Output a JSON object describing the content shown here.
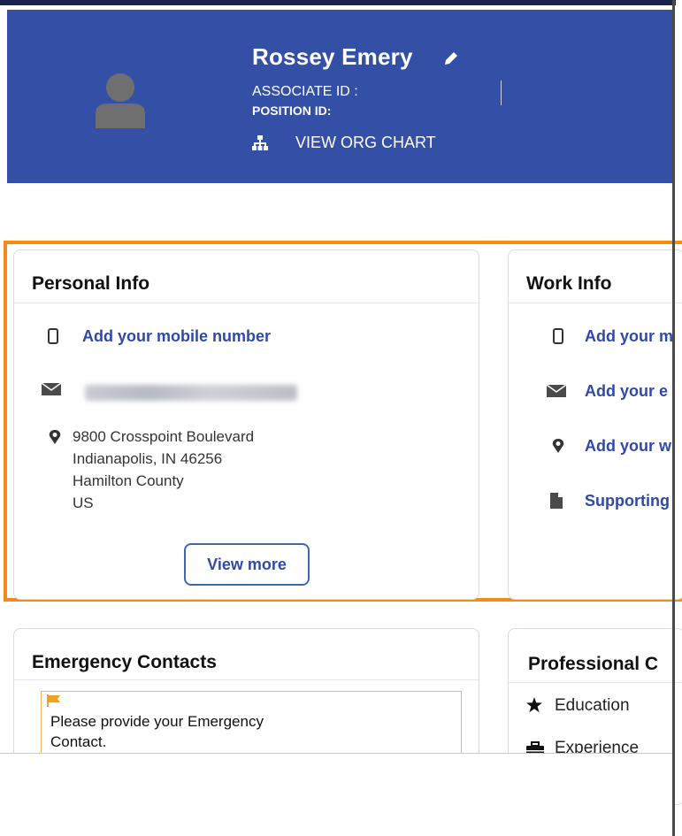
{
  "header": {
    "name": "Rossey Emery",
    "associate_id_label": "ASSOCIATE ID :",
    "position_id_label": "POSITION ID:",
    "org_chart_link": "VIEW ORG CHART",
    "colors": {
      "banner": "#3450a6",
      "text": "#ffffff"
    }
  },
  "personal_info": {
    "title": "Personal Info",
    "mobile_link": "Add your mobile number",
    "address_lines": [
      "9800 Crosspoint Boulevard",
      "Indianapolis, IN 46256",
      "Hamilton County",
      "US"
    ],
    "view_more_button": "View more"
  },
  "work_info": {
    "title": "Work Info",
    "items": [
      "Add your m",
      "Add your e",
      "Add your w",
      "Supporting"
    ]
  },
  "emergency_contacts": {
    "title": "Emergency Contacts",
    "notice": "Please provide your Emergency Contact."
  },
  "professional": {
    "title": "Professional C",
    "items": [
      "Education",
      "Experience"
    ]
  },
  "colors": {
    "highlight_border": "#f68a13",
    "link": "#2f49a8",
    "notice_border": "#f2b74e"
  }
}
